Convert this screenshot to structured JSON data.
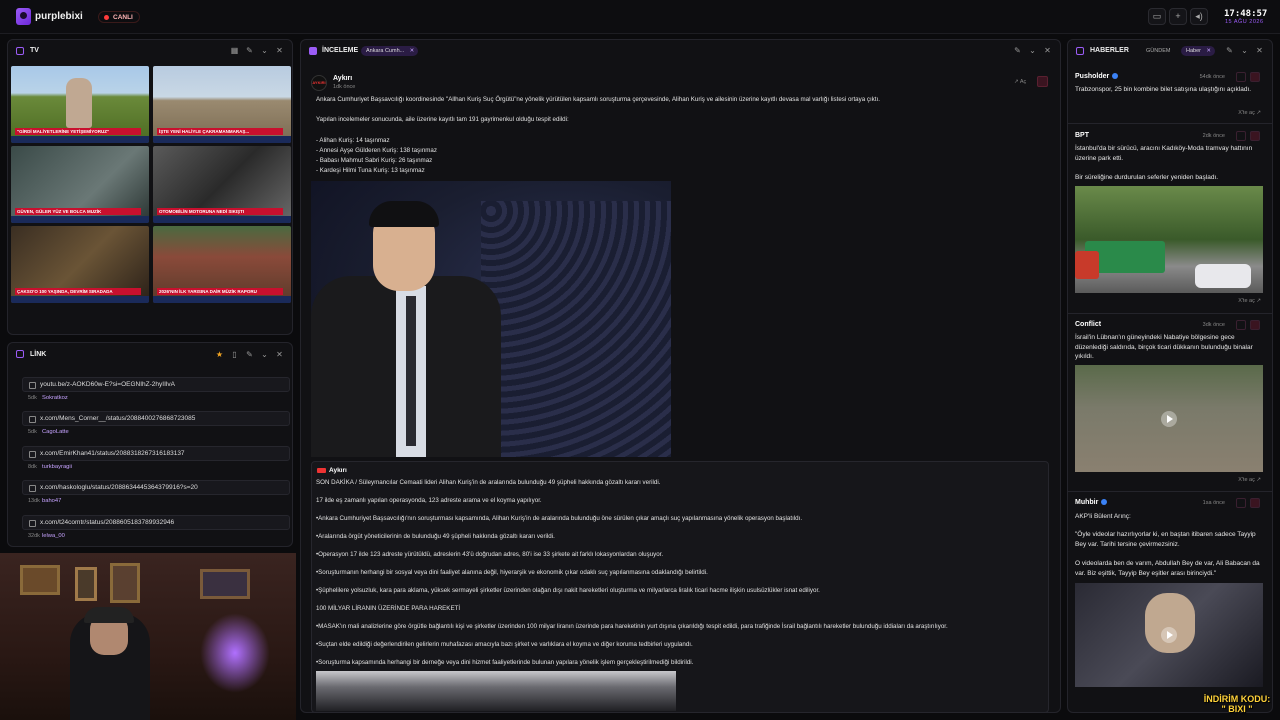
{
  "topbar": {
    "brand": "purplebixi",
    "live": "CANLI",
    "clock": "17:48:57",
    "date": "15 AĞU 2026"
  },
  "tv": {
    "title": "TV",
    "tiles": [
      {
        "caption": "\"GİRDİ MALİYETLERİNE YETİŞEMİYORUZ\""
      },
      {
        "caption": "İŞTE YENİ HALİYLE ÇAKRAMANMARAŞ..."
      },
      {
        "caption": "GÜVEN, GÜLER YÜZ VE BOLCA MUZİK"
      },
      {
        "caption": "OTOMOBİLİN MOTORUNA NEDİ SIKIŞTI"
      },
      {
        "caption": "ÇAKSO'O 100 YAŞINDA, DEVRİM SIRADADA"
      },
      {
        "caption": "2026'NIN İLK YARISINA DAİR MÜZİK RAPORU"
      }
    ]
  },
  "links": {
    "title": "LİNK",
    "items": [
      {
        "url": "youtu.be/z-AOKD60w-E?si=OEGNIhZ-2hyIIlvA",
        "meta": "5dk",
        "author": "Sokratkoz"
      },
      {
        "url": "x.com/Mens_Corner__/status/2088400276868723085",
        "meta": "5dk",
        "author": "CagoLatte"
      },
      {
        "url": "x.com/EmirKhan41/status/2088318267316183137",
        "meta": "8dk",
        "author": "turkbayragii"
      },
      {
        "url": "x.com/haskologlu/status/2088634445364379916?s=20",
        "meta": "13dk",
        "author": "baho47"
      },
      {
        "url": "x.com/t24comtr/status/2088605183789932946",
        "meta": "32dk",
        "author": "lelwa_00"
      }
    ]
  },
  "review": {
    "title": "İNCELEME",
    "chip": "Ankara Cumh...",
    "post": {
      "avatar": "AYKIRI",
      "source": "Aykırı",
      "ago": "1dk önce",
      "open": "Aç",
      "p1": "Ankara Cumhuriyet Başsavcılığı koordinesinde \"Allhan Kuriş Suç Örgütü\"ne yönelik yürütülen kapsamlı soruşturma çerçevesinde, Alihan Kuriş ve ailesinin üzerine kayıtlı devasa mal varlığı listesi ortaya çıktı.",
      "p2": "Yapılan incelemeler sonucunda, aile üzerine kayıtlı tam 191 gayrimenkul olduğu tespit edildi:",
      "l1": "- Alihan Kuriş: 14 taşınmaz",
      "l2": "- Annesi Ayşe Gülderen Kuriş: 138 taşınmaz",
      "l3": "- Babası Mahmut Sabri Kuriş: 26 taşınmaz",
      "l4": "- Kardeşi Hilmi Tuna Kuriş: 13 taşınmaz"
    },
    "quote": {
      "source": "Aykırı",
      "lines": [
        "SON DAKİKA / Süleymancılar Cemaati lideri Alihan Kuriş'in de aralarında bulunduğu 49 şüpheli hakkında gözaltı kararı verildi.",
        "17 ilde eş zamanlı yapılan operasyonda, 123 adreste arama ve el koyma yapılıyor.",
        "•Ankara Cumhuriyet Başsavcılığı'nın soruşturması kapsamında, Alihan Kuriş'in de aralarında bulunduğu öne sürülen çıkar amaçlı suç yapılanmasına yönelik operasyon başlatıldı.",
        "•Aralarında örgüt yöneticilerinin de bulunduğu 49 şüpheli hakkında gözaltı kararı verildi.",
        "•Operasyon 17 ilde 123 adreste yürütüldü, adreslerin 43'ü doğrudan adres, 80'i ise 33 şirkete ait farklı lokasyonlardan oluşuyor.",
        "•Soruşturmanın herhangi bir sosyal veya dini faaliyet alanına değil, hiyerarşik ve ekonomik çıkar odaklı suç yapılanmasına odaklandığı belirtildi.",
        "•Şüphelilere yolsuzluk, kara para aklama, yüksek sermayeli şirketler üzerinden olağan dışı nakit hareketleri oluşturma ve milyarlarca liralık ticari hacme ilişkin usulsüzlükler isnat ediliyor.",
        "100 MİLYAR LİRANIN ÜZERİNDE PARA HAREKETİ",
        "•MASAK'ın mali analizlerine göre örgütle bağlantılı kişi ve şirketler üzerinden 100 milyar liranın üzerinde para hareketinin yurt dışına çıkarıldığı tespit edildi, para trafiğinde İsrail bağlantılı hareketler bulunduğu iddiaları da araştırılıyor.",
        "•Suçtan elde edildiği değerlendirilen gelirlerin muhafazası amacıyla bazı şirket ve varlıklara el koyma ve diğer koruma tedbirleri uygulandı.",
        "•Soruşturma kapsamında herhangi bir derneğe veya dini hizmet faaliyetlerinde bulunan yapılara yönelik işlem gerçekleştirilmediği bildirildi."
      ]
    }
  },
  "news": {
    "title": "HABERLER",
    "tab": "GÜNDEM",
    "chip": "Haber",
    "expand": "X'te aç",
    "items": [
      {
        "source": "Pusholder",
        "ago": "54dk önce",
        "text": "Trabzonspor, 25 bin kombine bilet satışına ulaştığını açıkladı."
      },
      {
        "source": "BPT",
        "ago": "2dk önce",
        "text": "İstanbul'da bir sürücü, aracını Kadıköy-Moda tramvay hattının üzerine park etti.",
        "text2": "Bir süreliğine durdurulan seferler yeniden başladı."
      },
      {
        "source": "Conflict",
        "ago": "3dk önce",
        "text": "İsrail'in Lübnan'ın güneyindeki Nabatiye bölgesine gece düzenlediği saldırıda, birçok ticari dükkanın bulunduğu binalar yıkıldı."
      },
      {
        "source": "Muhbir",
        "ago": "1sa önce",
        "text": "AKP'li Bülent Arınç:",
        "text2": "\"Öyle videolar hazırlıyorlar ki, en baştan itibaren sadece Tayyip Bey var. Tarihi tersine çevirmezsiniz.",
        "text3": "O videolarda ben de varım, Abdullah Bey de var, Ali Babacan da var. Biz eşittik, Tayyip Bey eşitler arası birinciydi.\""
      }
    ]
  },
  "promo": {
    "line1": "İNDİRİM KODU:",
    "line2": "\" BIXI \""
  },
  "colors": {
    "accent": "#9b5cf6",
    "live": "#ff3b3b",
    "verified": "#3b82f6"
  }
}
